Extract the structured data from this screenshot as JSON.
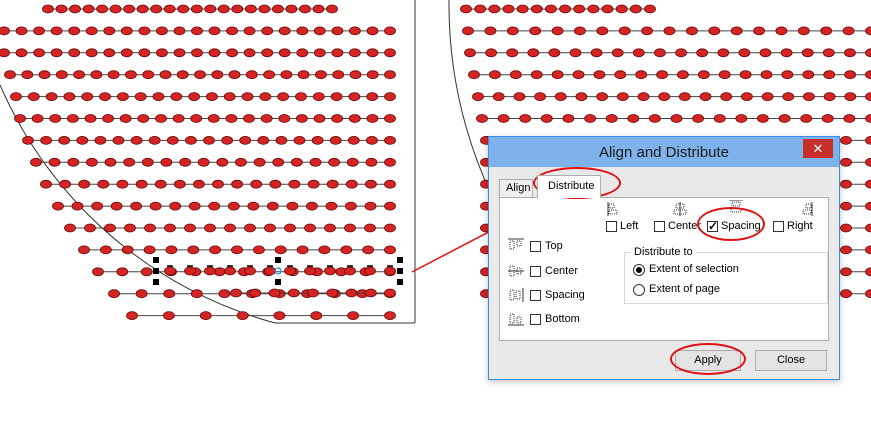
{
  "dialog": {
    "title": "Align and Distribute",
    "close_glyph": "✕",
    "tabs": [
      {
        "label": "Align",
        "active": false
      },
      {
        "label": "Distribute",
        "active": true
      }
    ],
    "horizontal_options": [
      {
        "label": "Left",
        "checked": false,
        "icon": "distribute-left-icon"
      },
      {
        "label": "Center",
        "checked": false,
        "icon": "distribute-center-icon"
      },
      {
        "label": "Spacing",
        "checked": true,
        "icon": "distribute-spacing-icon"
      },
      {
        "label": "Right",
        "checked": false,
        "icon": "distribute-right-icon"
      }
    ],
    "vertical_options": [
      {
        "label": "Top",
        "checked": false,
        "icon": "distribute-top-icon"
      },
      {
        "label": "Center",
        "checked": false,
        "icon": "distribute-vcenter-icon"
      },
      {
        "label": "Spacing",
        "checked": false,
        "icon": "distribute-vspacing-icon"
      },
      {
        "label": "Bottom",
        "checked": false,
        "icon": "distribute-bottom-icon"
      }
    ],
    "distribute_to": {
      "title": "Distribute to",
      "options": [
        {
          "label": "Extent of selection",
          "selected": true
        },
        {
          "label": "Extent of page",
          "selected": false
        }
      ]
    },
    "buttons": {
      "apply": "Apply",
      "close": "Close"
    }
  },
  "colors": {
    "seat_fill": "#d42424",
    "seat_stroke": "#6a0a0a",
    "titlebar": "#7db3ea",
    "close_button": "#c7302a",
    "annotation": "#e01010"
  },
  "canvas": {
    "left_rows_seat_counts": [
      22,
      23,
      23,
      23,
      22,
      22,
      21,
      20,
      19,
      18,
      17,
      15,
      13,
      11,
      8
    ],
    "right_rows_seat_counts": [
      14,
      19,
      20,
      20,
      20,
      19,
      18,
      17,
      16,
      15,
      14,
      13,
      12,
      11
    ],
    "selected_row_seat_count": 12
  }
}
